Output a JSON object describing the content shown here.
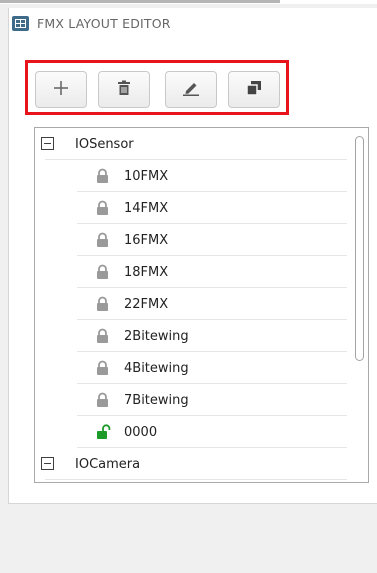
{
  "header": {
    "title": "FMX LAYOUT EDITOR"
  },
  "toolbar": {
    "highlight_color": "#e8141c",
    "buttons": [
      {
        "icon": "plus-icon"
      },
      {
        "icon": "trash-icon"
      },
      {
        "icon": "pencil-icon"
      },
      {
        "icon": "duplicate-icon"
      }
    ]
  },
  "tree": {
    "groups": [
      {
        "label": "IOSensor",
        "state": "expanded",
        "items": [
          {
            "label": "10FMX",
            "icon": "lock-icon",
            "locked": true
          },
          {
            "label": "14FMX",
            "icon": "lock-icon",
            "locked": true
          },
          {
            "label": "16FMX",
            "icon": "lock-icon",
            "locked": true
          },
          {
            "label": "18FMX",
            "icon": "lock-icon",
            "locked": true
          },
          {
            "label": "22FMX",
            "icon": "lock-icon",
            "locked": true
          },
          {
            "label": "2Bitewing",
            "icon": "lock-icon",
            "locked": true
          },
          {
            "label": "4Bitewing",
            "icon": "lock-icon",
            "locked": true
          },
          {
            "label": "7Bitewing",
            "icon": "lock-icon",
            "locked": true
          },
          {
            "label": "0000",
            "icon": "unlock-icon",
            "locked": false
          }
        ]
      },
      {
        "label": "IOCamera",
        "state": "expanded",
        "items": []
      }
    ]
  },
  "colors": {
    "locked": "#9a9a9a",
    "unlocked": "#1c9b2a"
  }
}
